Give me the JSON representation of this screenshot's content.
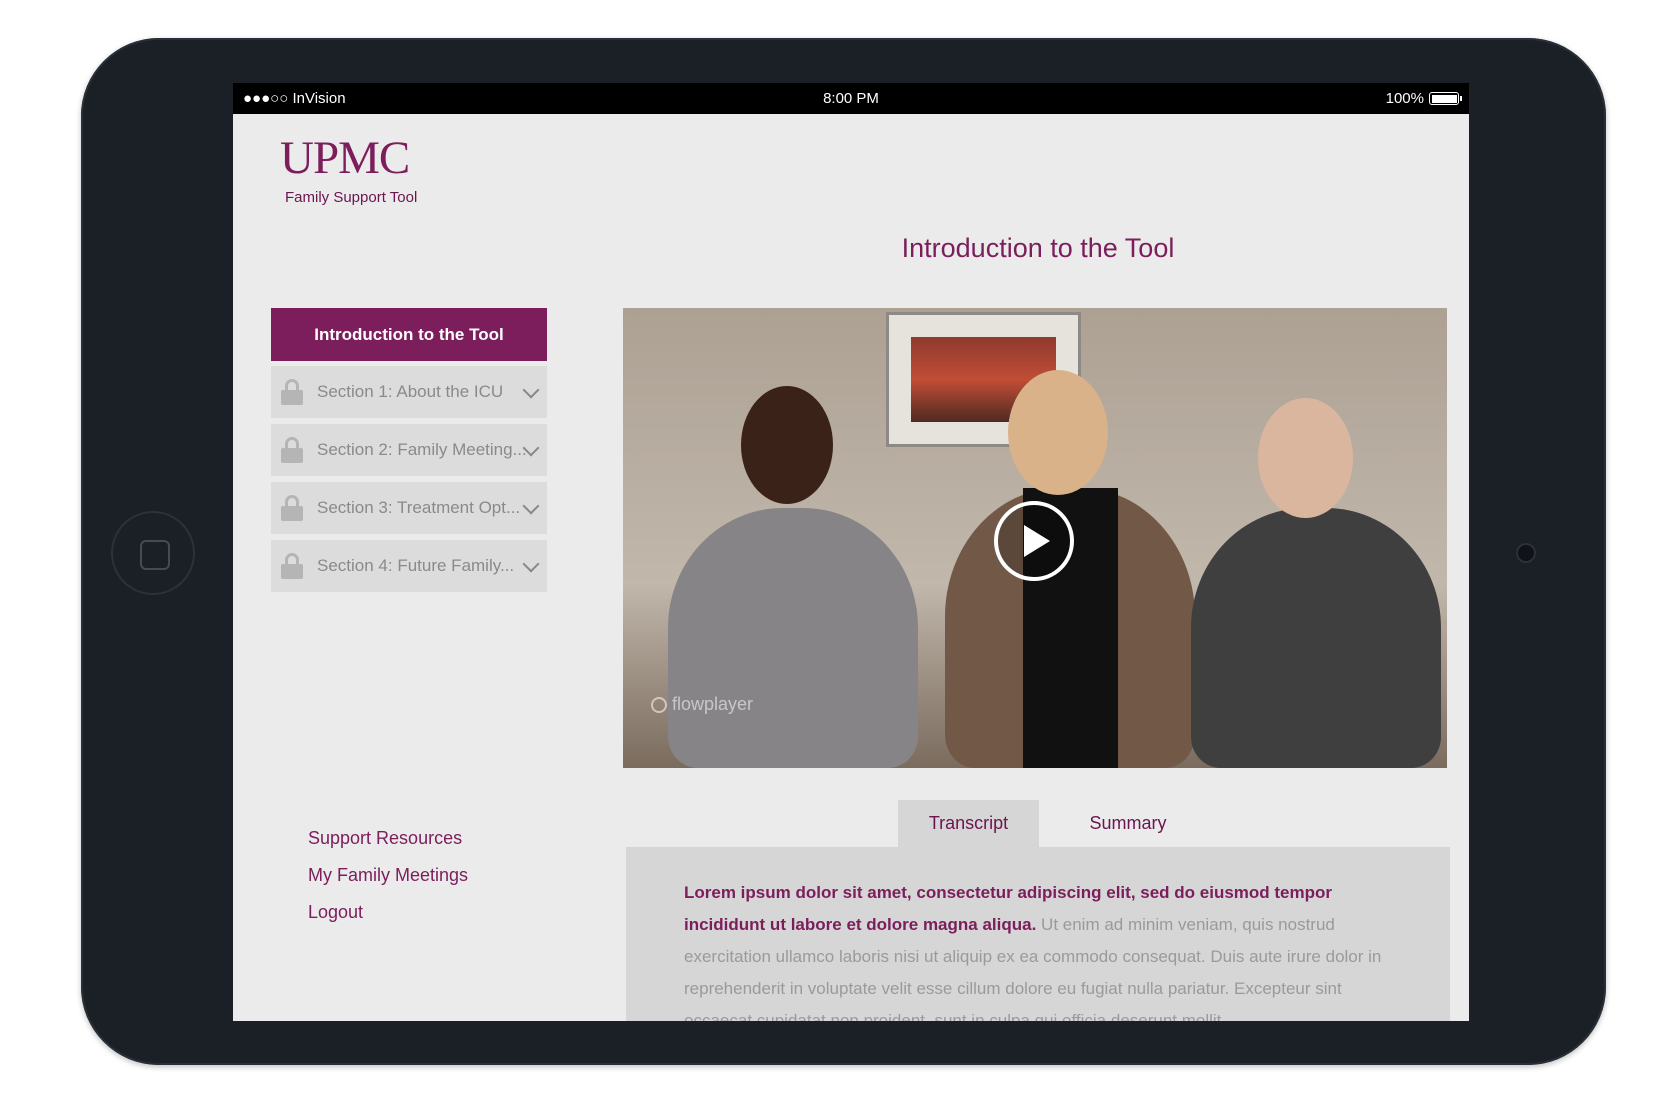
{
  "statusbar": {
    "carrier": "●●●○○ InVision",
    "time": "8:00 PM",
    "battery": "100%"
  },
  "brand": {
    "logo": "UPMC",
    "subtitle": "Family Support Tool"
  },
  "page": {
    "title": "Introduction to the Tool"
  },
  "nav": {
    "active": "Introduction to the Tool",
    "items": [
      {
        "label": "Section 1: About the ICU"
      },
      {
        "label": "Section 2: Family Meeting..."
      },
      {
        "label": "Section 3: Treatment Opt..."
      },
      {
        "label": "Section 4: Future Family..."
      }
    ]
  },
  "links": {
    "support": "Support Resources",
    "meetings": "My Family Meetings",
    "logout": "Logout"
  },
  "video": {
    "watermark": "flowplayer"
  },
  "tabs": {
    "transcript": "Transcript",
    "summary": "Summary"
  },
  "transcript": {
    "bold": "Lorem ipsum dolor sit amet, consectetur adipiscing elit, sed do eiusmod tempor incididunt ut labore et dolore magna aliqua.",
    "body": " Ut enim ad minim veniam, quis nostrud exercitation ullamco laboris nisi ut aliquip ex ea commodo consequat. Duis aute irure dolor in reprehenderit in voluptate velit esse cillum dolore eu fugiat nulla pariatur. Excepteur sint occaecat cupidatat non proident, sunt in culpa qui officia deserunt mollit"
  },
  "colors": {
    "brand": "#7b1e5b",
    "screen_bg": "#ebebeb",
    "device": "#1b1f26"
  }
}
